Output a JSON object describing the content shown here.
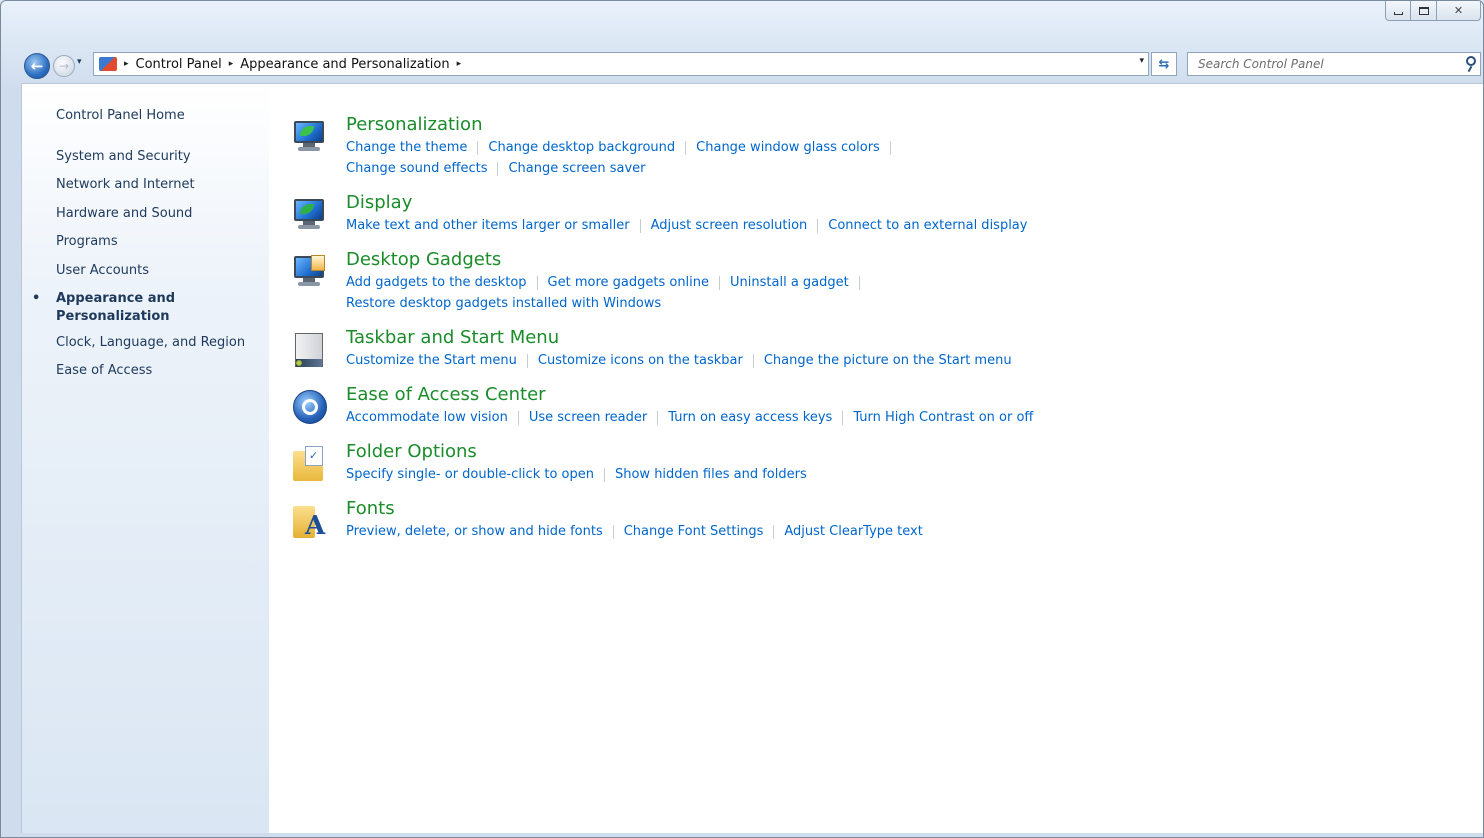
{
  "window": {
    "caption": {
      "minimize": "▭",
      "maximize": "▢",
      "close": "✕"
    }
  },
  "toolbar": {
    "back_glyph": "←",
    "forward_glyph": "→",
    "history_glyph": "▾",
    "breadcrumb": [
      "Control Panel",
      "Appearance and Personalization"
    ],
    "crumb_separator": "▸",
    "dropdown_glyph": "▾",
    "refresh_glyph": "⇆",
    "search_placeholder": "Search Control Panel"
  },
  "sidebar": {
    "home": "Control Panel Home",
    "items": [
      {
        "label": "System and Security"
      },
      {
        "label": "Network and Internet"
      },
      {
        "label": "Hardware and Sound"
      },
      {
        "label": "Programs"
      },
      {
        "label": "User Accounts"
      },
      {
        "label": "Appearance and Personalization",
        "current": true
      },
      {
        "label": "Clock, Language, and Region"
      },
      {
        "label": "Ease of Access"
      }
    ],
    "bullet": "•"
  },
  "categories": [
    {
      "title": "Personalization",
      "icon": "personalization-icon",
      "lines": [
        [
          "Change the theme",
          "Change desktop background",
          "Change window glass colors"
        ],
        [
          "Change sound effects",
          "Change screen saver"
        ]
      ]
    },
    {
      "title": "Display",
      "icon": "display-icon",
      "lines": [
        [
          "Make text and other items larger or smaller",
          "Adjust screen resolution",
          "Connect to an external display"
        ]
      ]
    },
    {
      "title": "Desktop Gadgets",
      "icon": "gadgets-icon",
      "lines": [
        [
          "Add gadgets to the desktop",
          "Get more gadgets online",
          "Uninstall a gadget"
        ],
        [
          "Restore desktop gadgets installed with Windows"
        ]
      ]
    },
    {
      "title": "Taskbar and Start Menu",
      "icon": "taskbar-icon",
      "lines": [
        [
          "Customize the Start menu",
          "Customize icons on the taskbar",
          "Change the picture on the Start menu"
        ]
      ]
    },
    {
      "title": "Ease of Access Center",
      "icon": "ease-of-access-icon",
      "lines": [
        [
          "Accommodate low vision",
          "Use screen reader",
          "Turn on easy access keys",
          "Turn High Contrast on or off"
        ]
      ]
    },
    {
      "title": "Folder Options",
      "icon": "folder-options-icon",
      "lines": [
        [
          "Specify single- or double-click to open",
          "Show hidden files and folders"
        ]
      ]
    },
    {
      "title": "Fonts",
      "icon": "fonts-icon",
      "lines": [
        [
          "Preview, delete, or show and hide fonts",
          "Change Font Settings",
          "Adjust ClearType text"
        ]
      ]
    }
  ],
  "colors": {
    "category_title": "#1a8c2a",
    "task_link": "#0066cc",
    "sidebar_text": "#1e395b"
  }
}
